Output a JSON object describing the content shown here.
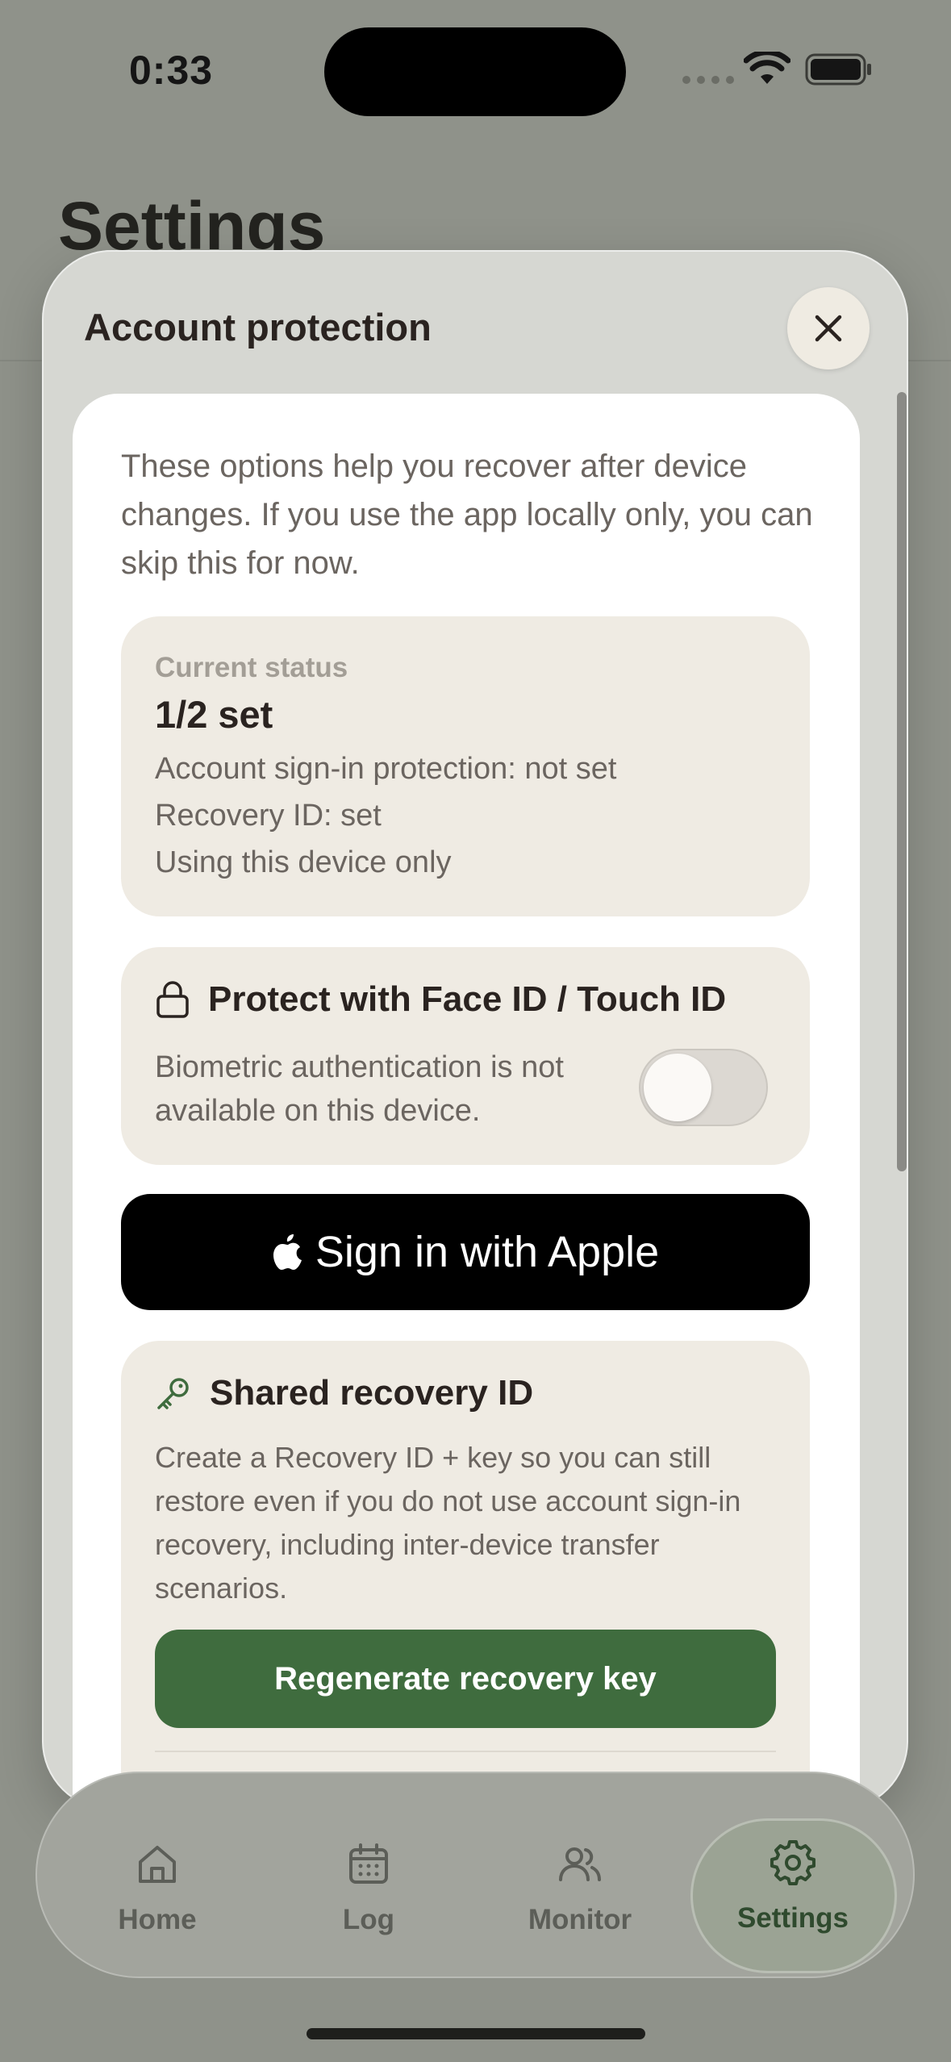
{
  "status_bar": {
    "time": "0:33"
  },
  "background": {
    "title": "Settings"
  },
  "sheet": {
    "title": "Account protection",
    "intro": "These options help you recover after device changes. If you use the app locally only, you can skip this for now.",
    "status": {
      "label": "Current status",
      "value": "1/2 set",
      "lines": [
        "Account sign-in protection: not set",
        "Recovery ID: set",
        "Using this device only"
      ]
    },
    "biometric": {
      "title": "Protect with Face ID / Touch ID",
      "description": "Biometric authentication is not available on this device.",
      "toggle_on": false
    },
    "apple_button": "Sign in with Apple",
    "recovery": {
      "title": "Shared recovery ID",
      "description": "Create a Recovery ID + key so you can still restore even if you do not use account sign-in recovery, including inter-device transfer scenarios.",
      "button": "Regenerate recovery key"
    }
  },
  "tabs": [
    {
      "label": "Home",
      "icon": "home-icon"
    },
    {
      "label": "Log",
      "icon": "calendar-icon"
    },
    {
      "label": "Monitor",
      "icon": "people-icon"
    },
    {
      "label": "Settings",
      "icon": "gear-icon",
      "active": true
    }
  ],
  "colors": {
    "accent_green": "#3f6c3e",
    "panel": "#efebe3",
    "text_dark": "#2a2320"
  }
}
